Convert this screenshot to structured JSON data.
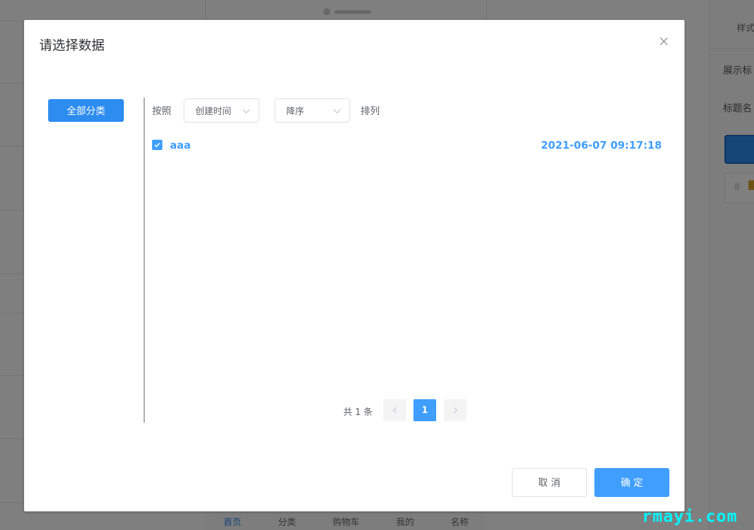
{
  "background": {
    "phone_tabs": [
      {
        "label": "首页",
        "active": true
      },
      {
        "label": "分类",
        "active": false
      },
      {
        "label": "购物车",
        "active": false
      },
      {
        "label": "我的",
        "active": false
      },
      {
        "label": "名称",
        "active": false
      }
    ],
    "right_panel": {
      "tab_label": "样式",
      "label_1": "展示标",
      "label_2": "标题名"
    }
  },
  "dialog": {
    "title": "请选择数据",
    "close_icon": "close-icon",
    "category_button": "全部分类",
    "sort_by_label": "按照",
    "sort_field": {
      "selected": "创建时间"
    },
    "sort_order": {
      "selected": "降序"
    },
    "arrange_label": "排列",
    "items": [
      {
        "name": "aaa",
        "created": "2021-06-07 09:17:18",
        "checked": true
      }
    ],
    "pagination": {
      "total_text": "共 1 条",
      "current_page": "1"
    },
    "cancel_label": "取 消",
    "confirm_label": "确 定"
  },
  "watermark": "rmayi.com",
  "colors": {
    "primary": "#409eff",
    "category_button": "#2d8cf0",
    "overlay": "rgba(0,0,0,0.5)"
  }
}
